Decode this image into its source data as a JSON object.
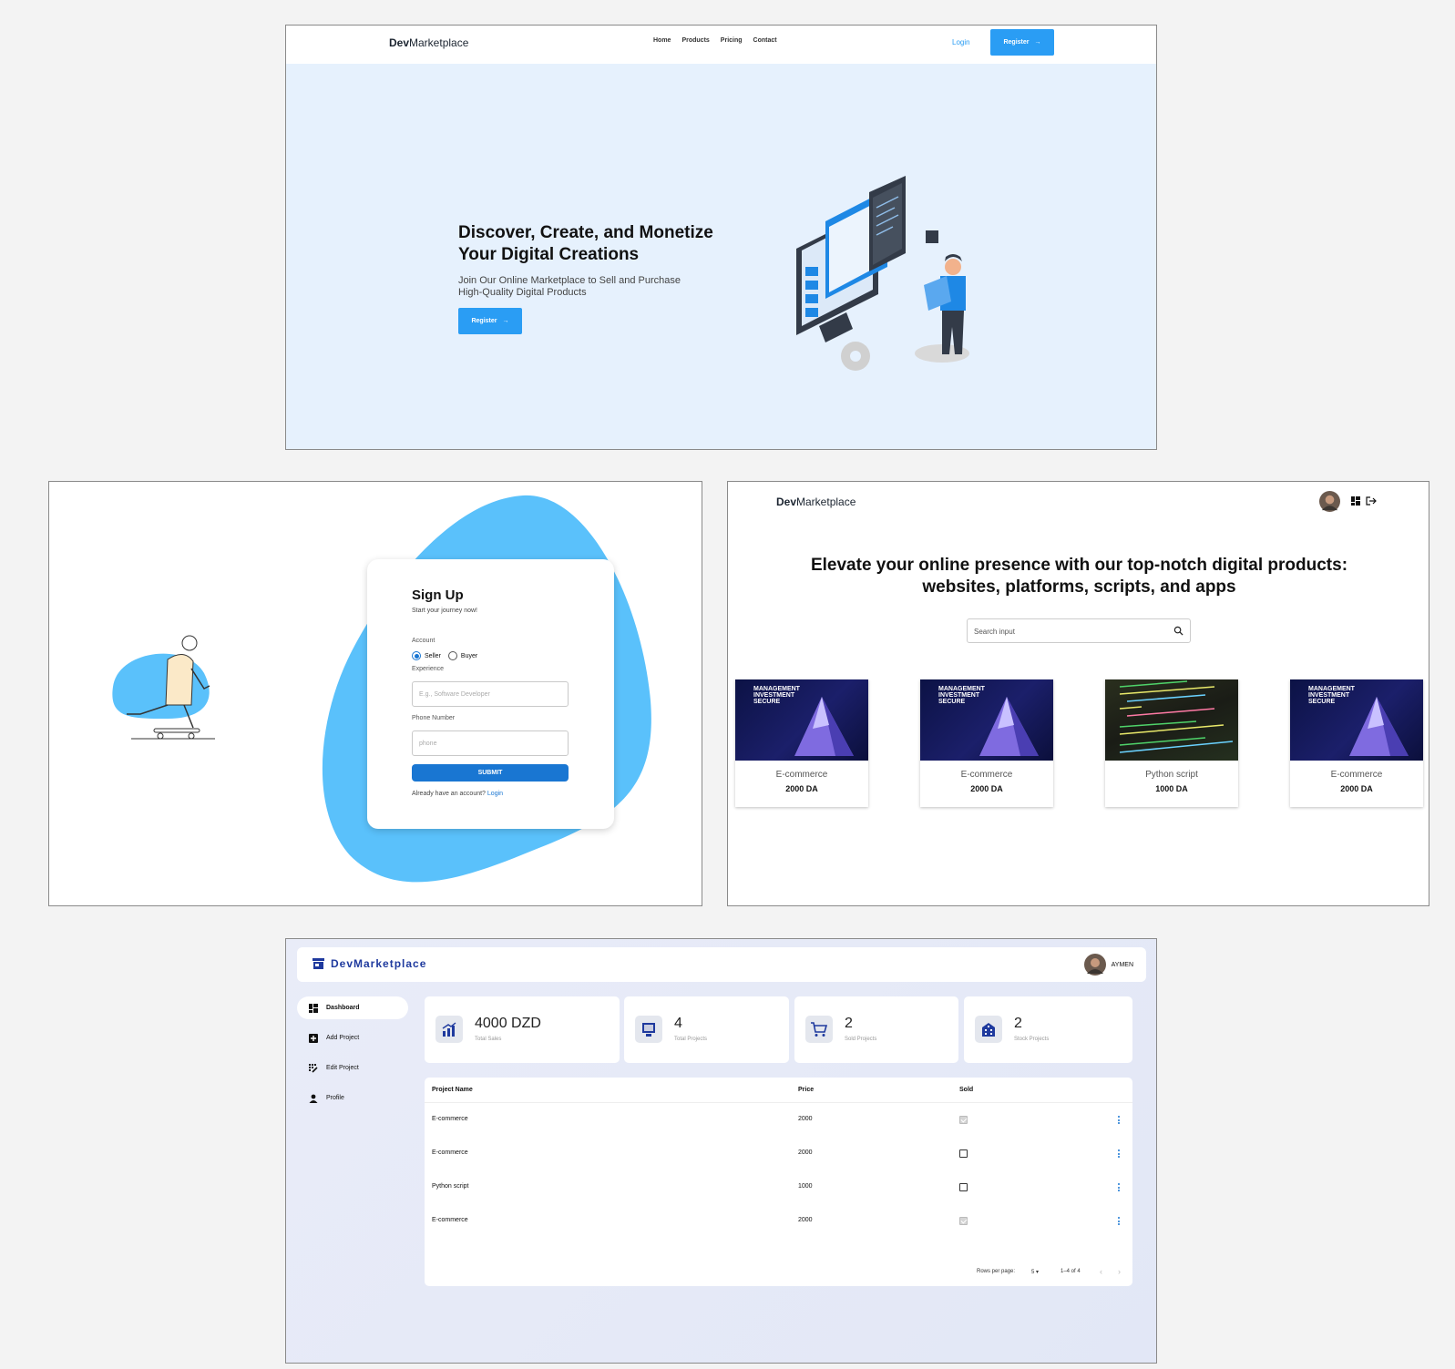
{
  "landing": {
    "logo_bold": "Dev",
    "logo_rest": "Marketplace",
    "nav": [
      "Home",
      "Products",
      "Pricing",
      "Contact"
    ],
    "login": "Login",
    "register": "Register",
    "hero_title": "Discover, Create, and Monetize Your Digital Creations",
    "hero_sub": "Join Our Online Marketplace to Sell and Purchase High-Quality Digital Products",
    "hero_button": "Register"
  },
  "signup": {
    "title": "Sign Up",
    "subtitle": "Start your journey now!",
    "account_label": "Account",
    "options": [
      "Seller",
      "Buyer"
    ],
    "selected_option": "Seller",
    "experience_label": "Experience",
    "experience_placeholder": "E.g., Software Developer",
    "phone_label": "Phone Number",
    "phone_placeholder": "phone",
    "submit": "SUBMIT",
    "already": "Already have an account?",
    "login_link": "Login",
    "blob_color": "#5ac1fb"
  },
  "products": {
    "logo_bold": "Dev",
    "logo_rest": "Marketplace",
    "headline": "Elevate your online presence with our top-notch digital products: websites, platforms, scripts, and apps",
    "search_placeholder": "Search input",
    "items": [
      {
        "name": "E-commerce",
        "price": "2000 DA",
        "thumb_text": "MANAGEMENT INVESTMENT SECURE"
      },
      {
        "name": "E-commerce",
        "price": "2000 DA",
        "thumb_text": "MANAGEMENT INVESTMENT SECURE"
      },
      {
        "name": "Python script",
        "price": "1000 DA",
        "thumb_text": ""
      },
      {
        "name": "E-commerce",
        "price": "2000 DA",
        "thumb_text": "MANAGEMENT INVESTMENT SECURE"
      }
    ]
  },
  "dashboard": {
    "brand": "DevMarketplace",
    "user": "AYMEN",
    "sidebar": [
      "Dashboard",
      "Add Project",
      "Edit Project",
      "Profile"
    ],
    "active_item": "Dashboard",
    "stats": [
      {
        "value": "4000 DZD",
        "caption": "Total Sales",
        "icon": "chart-icon"
      },
      {
        "value": "4",
        "caption": "Total Projects",
        "icon": "projects-icon"
      },
      {
        "value": "2",
        "caption": "Sold Projects",
        "icon": "cart-icon"
      },
      {
        "value": "2",
        "caption": "Stock Projects",
        "icon": "building-icon"
      }
    ],
    "columns": [
      "Project Name",
      "Price",
      "Sold"
    ],
    "rows": [
      {
        "name": "E-commerce",
        "price": "2000",
        "sold": true
      },
      {
        "name": "E-commerce",
        "price": "2000",
        "sold": false
      },
      {
        "name": "Python script",
        "price": "1000",
        "sold": false
      },
      {
        "name": "E-commerce",
        "price": "2000",
        "sold": true
      }
    ],
    "rows_per_page_label": "Rows per page:",
    "rows_per_page": "5",
    "range": "1–4 of 4"
  },
  "colors": {
    "accent": "#2a9df4",
    "primary": "#1976d2",
    "brand": "#1f3a9e"
  }
}
